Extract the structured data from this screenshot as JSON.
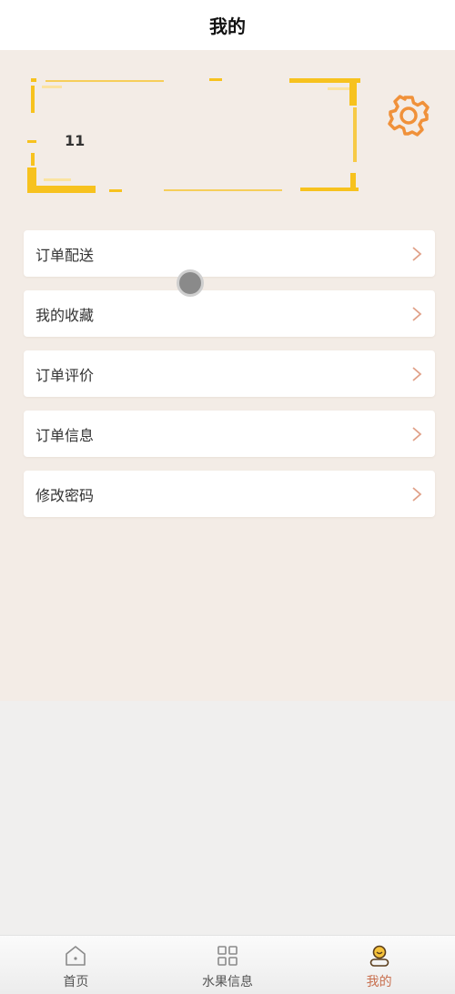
{
  "header": {
    "title": "我的"
  },
  "profile": {
    "name": "11"
  },
  "settings": {
    "icon": "gear-icon",
    "color": "#f0913a"
  },
  "menu": {
    "items": [
      {
        "label": "订单配送"
      },
      {
        "label": "我的收藏"
      },
      {
        "label": "订单评价"
      },
      {
        "label": "订单信息"
      },
      {
        "label": "修改密码"
      }
    ]
  },
  "tabbar": {
    "items": [
      {
        "label": "首页",
        "icon": "home-icon",
        "active": false
      },
      {
        "label": "水果信息",
        "icon": "grid-icon",
        "active": false
      },
      {
        "label": "我的",
        "icon": "user-icon",
        "active": true
      }
    ]
  },
  "colors": {
    "accent": "#c86f4e",
    "frame": "#f5c518",
    "background": "#f3ece6"
  }
}
